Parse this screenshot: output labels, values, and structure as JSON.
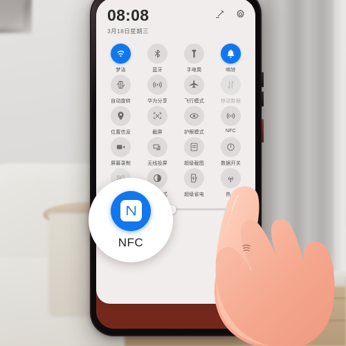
{
  "scene": {
    "description": "huawei-quick-settings-nfc-tutorial",
    "background": "blurred living room with sofa, side table, curtain"
  },
  "phone": {
    "wallpaper_color": "#7d2d1e",
    "bezel_color": "#151113"
  },
  "panel": {
    "background": "#f1eded",
    "clock": "08:08",
    "date": "3月18日星期三",
    "header_icons": [
      {
        "name": "edit-icon",
        "label": "编辑"
      },
      {
        "name": "settings-icon",
        "label": "设置"
      }
    ],
    "accent_color": "#1277ec",
    "tile_rows": [
      [
        {
          "label": "梦洁",
          "icon": "wifi-icon",
          "state": "on"
        },
        {
          "label": "蓝牙",
          "icon": "bluetooth-icon",
          "state": "off"
        },
        {
          "label": "手电筒",
          "icon": "flashlight-icon",
          "state": "off"
        },
        {
          "label": "响铃",
          "icon": "bell-icon",
          "state": "on"
        }
      ],
      [
        {
          "label": "自动旋转",
          "icon": "auto-rotate-icon",
          "state": "off"
        },
        {
          "label": "华为分享",
          "icon": "huawei-share-icon",
          "state": "off"
        },
        {
          "label": "飞行模式",
          "icon": "airplane-icon",
          "state": "off"
        },
        {
          "label": "移动数据",
          "icon": "mobile-data-icon",
          "state": "disabled"
        }
      ],
      [
        {
          "label": "位置信息",
          "icon": "location-pin-icon",
          "state": "off"
        },
        {
          "label": "截屏",
          "icon": "screenshot-icon",
          "state": "off"
        },
        {
          "label": "护眼模式",
          "icon": "eye-comfort-icon",
          "state": "off"
        },
        {
          "label": "NFC",
          "icon": "nfc-icon",
          "state": "off"
        }
      ],
      [
        {
          "label": "屏幕录制",
          "icon": "screen-record-icon",
          "state": "off"
        },
        {
          "label": "无线投屏",
          "icon": "wireless-cast-icon",
          "state": "off"
        },
        {
          "label": "超级截图",
          "icon": "super-screenshot-icon",
          "state": "off"
        },
        {
          "label": "数据开关",
          "icon": "data-switch-icon",
          "state": "off"
        }
      ],
      [
        {
          "label": "5G",
          "icon": "5g-icon",
          "state": "disabled"
        },
        {
          "label": "深色模式",
          "icon": "dark-mode-icon",
          "state": "off"
        },
        {
          "label": "超级省电",
          "icon": "power-saving-icon",
          "state": "off"
        },
        {
          "label": "热点",
          "icon": "hotspot-icon",
          "state": "off"
        }
      ]
    ],
    "brightness": {
      "value_percent": 47,
      "low_icon": "brightness-low-icon",
      "high_icon": "brightness-high-icon",
      "handle_icon": "chevron-up-handle-icon"
    }
  },
  "callout": {
    "label": "NFC",
    "icon": "nfc-icon",
    "icon_background": "#1277ec",
    "pointer": "hand-pointing-icon"
  }
}
